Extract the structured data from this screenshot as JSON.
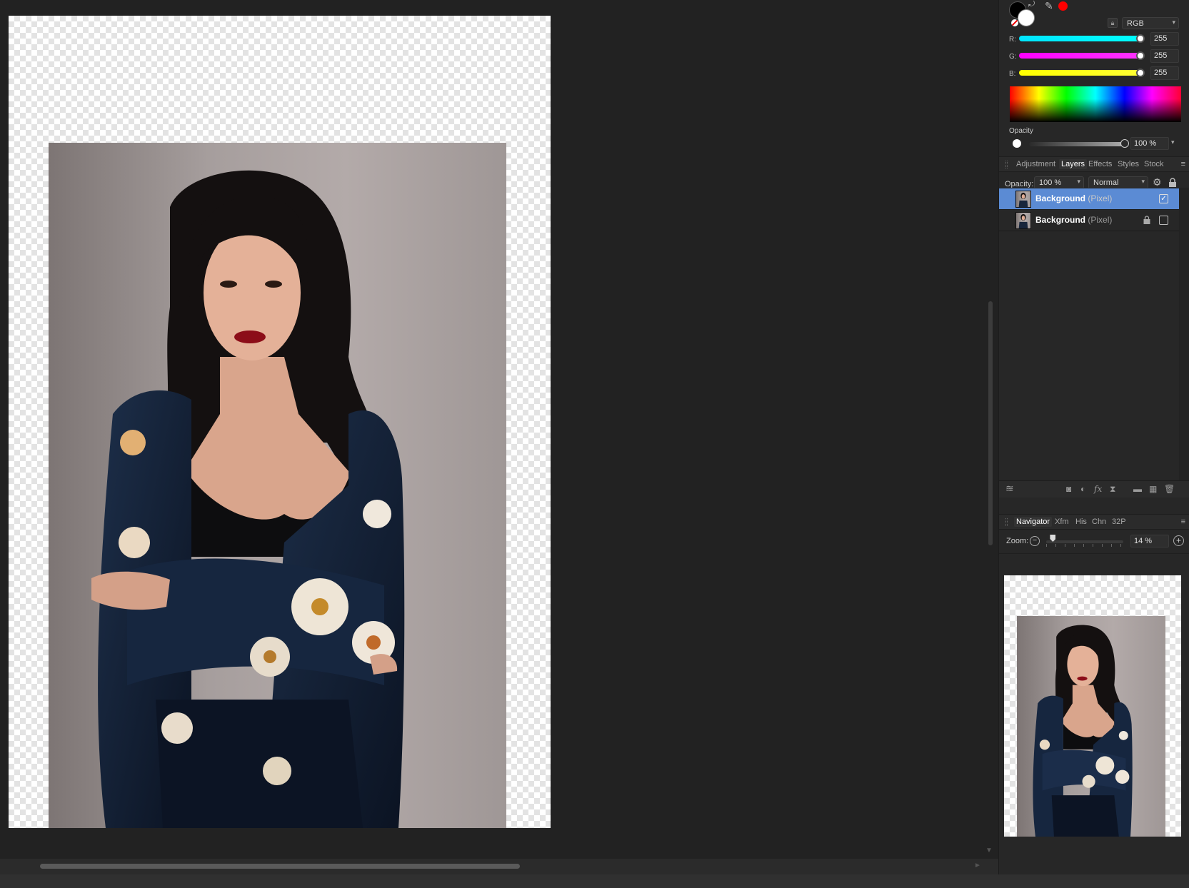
{
  "color_panel": {
    "model": "RGB",
    "channels": [
      {
        "label": "R:",
        "value": "255",
        "gradient": [
          "#00e5ff",
          "#00ffff"
        ]
      },
      {
        "label": "G:",
        "value": "255",
        "gradient": [
          "#ff00ff",
          "#ff33ff"
        ]
      },
      {
        "label": "B:",
        "value": "255",
        "gradient": [
          "#ffff00",
          "#ffff33"
        ]
      }
    ],
    "opacity_label": "Opacity",
    "opacity_value": "100 %",
    "fg_color": "#000000",
    "bg_color": "#ffffff",
    "accent_swatch": "#ff0000"
  },
  "studio_tabs": [
    "Adjustment",
    "Layers",
    "Effects",
    "Styles",
    "Stock"
  ],
  "active_studio_tab": "Layers",
  "layers": {
    "opacity_label": "Opacity:",
    "opacity_value": "100 %",
    "blend_mode": "Normal",
    "items": [
      {
        "name": "Background",
        "type": "(Pixel)",
        "selected": true,
        "visible": true,
        "locked": false
      },
      {
        "name": "Background",
        "type": "(Pixel)",
        "selected": false,
        "visible": false,
        "locked": true
      }
    ]
  },
  "layer_toolbar_icons": [
    "layers-stack-icon",
    "mask-icon",
    "adjustment-icon",
    "fx-icon",
    "live-filter-icon",
    "group-folder-icon",
    "pixel-layer-icon",
    "trash-icon"
  ],
  "nav_tabs": [
    "Navigator",
    "Xfm",
    "His",
    "Chn",
    "32P"
  ],
  "active_nav_tab": "Navigator",
  "navigator": {
    "zoom_label": "Zoom:",
    "zoom_value": "14 %",
    "zoom_fraction": 0.05
  },
  "accent_selection": "#5b8bd4"
}
